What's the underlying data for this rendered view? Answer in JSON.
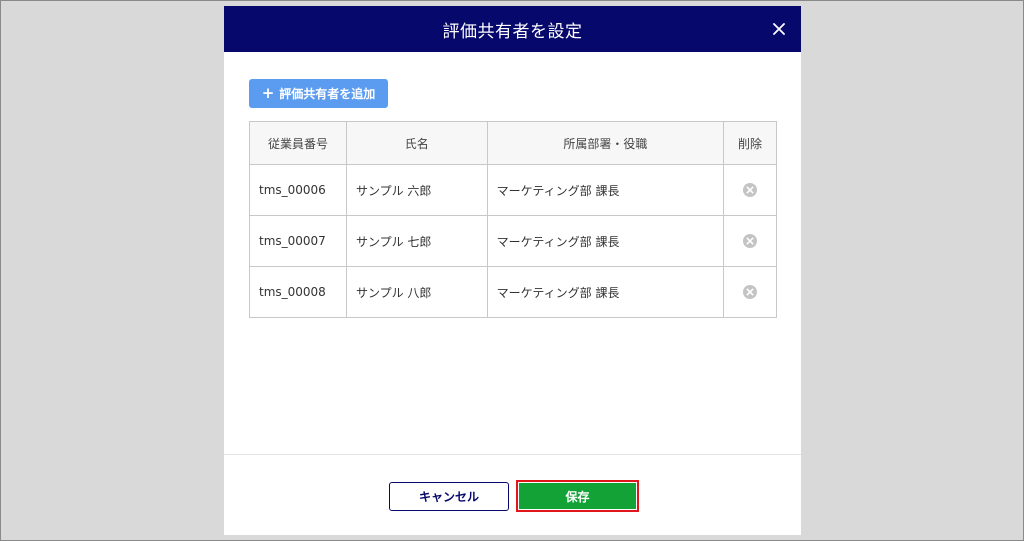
{
  "modal": {
    "title": "評価共有者を設定",
    "close_icon": "close-icon"
  },
  "add_button": {
    "icon": "plus-icon",
    "label": "評価共有者を追加"
  },
  "table": {
    "headers": [
      "従業員番号",
      "氏名",
      "所属部署・役職",
      "削除"
    ],
    "rows": [
      {
        "employee_id": "tms_00006",
        "name": "サンプル 六郎",
        "department": "マーケティング部 課長",
        "delete_icon": "remove-circle-icon"
      },
      {
        "employee_id": "tms_00007",
        "name": "サンプル 七郎",
        "department": "マーケティング部 課長",
        "delete_icon": "remove-circle-icon"
      },
      {
        "employee_id": "tms_00008",
        "name": "サンプル 八郎",
        "department": "マーケティング部 課長",
        "delete_icon": "remove-circle-icon"
      }
    ]
  },
  "footer": {
    "cancel_label": "キャンセル",
    "save_label": "保存"
  },
  "colors": {
    "header_bg": "#07086b",
    "add_button_bg": "#5b9cf0",
    "save_button_bg": "#12a236",
    "highlight_border": "#e0161b",
    "overlay_bg": "#d9d9d9"
  }
}
